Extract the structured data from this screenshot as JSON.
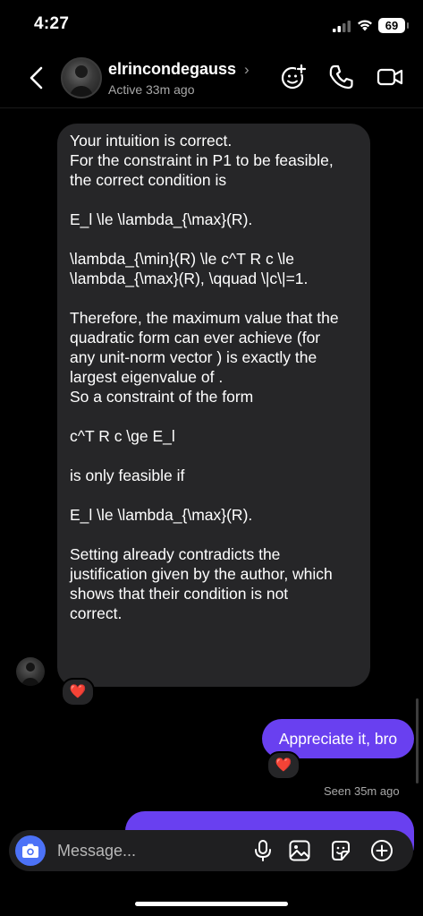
{
  "status_bar": {
    "time": "4:27",
    "battery": "69"
  },
  "header": {
    "username": "elrincondegauss",
    "username_chevron": "›",
    "active_status": "Active 33m ago"
  },
  "icons": {
    "back": "chevron-left-icon",
    "add_people": "add-people-icon",
    "call": "phone-icon",
    "video": "video-icon",
    "camera": "camera-icon",
    "mic": "microphone-icon",
    "gallery": "image-icon",
    "sticker": "sticker-icon",
    "more": "plus-circle-icon"
  },
  "conversation": {
    "incoming_message": {
      "lines": [
        "Your intuition is correct.",
        "For the constraint in P1 to be feasible,",
        "the correct condition is",
        "",
        "E_l \\le \\lambda_{\\max}(R).",
        "",
        "\\lambda_{\\min}(R) \\le c^T R c \\le",
        "\\lambda_{\\max}(R), \\qquad \\|c\\|=1.",
        "",
        "Therefore, the maximum value that the",
        "quadratic form  can ever achieve (for",
        "any unit-norm vector ) is exactly the",
        "largest eigenvalue of .",
        "So a constraint of the form",
        "",
        "c^T R c \\ge E_l",
        "",
        "is only feasible if",
        "",
        "E_l \\le \\lambda_{\\max}(R).",
        "",
        "Setting  already contradicts the",
        "justification given by the author, which",
        "shows that their condition is not",
        "correct."
      ],
      "reaction": "❤️"
    },
    "outgoing_message": {
      "text": "Appreciate it, bro",
      "reaction": "❤️"
    },
    "seen_status": "Seen 35m ago"
  },
  "composer": {
    "placeholder": "Message..."
  },
  "colors": {
    "background": "#000000",
    "incoming_bubble": "#262628",
    "outgoing_bubble": "#6940f0",
    "camera_button": "#4c72f7",
    "secondary_text": "#a8a8a8"
  }
}
